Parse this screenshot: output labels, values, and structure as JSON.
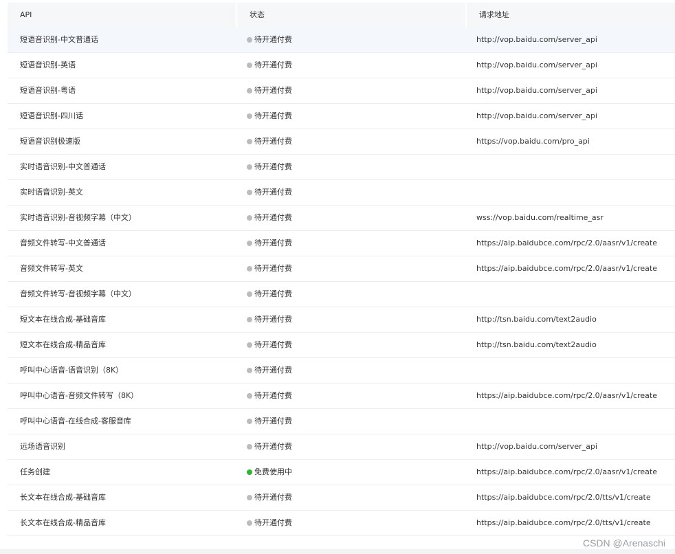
{
  "table": {
    "headers": {
      "api": "API",
      "status": "状态",
      "url": "请求地址"
    },
    "status_colors": {
      "pending": "#b9bcc1",
      "active": "#32b332"
    },
    "rows": [
      {
        "api": "短语音识别-中文普通话",
        "status": "待开通付费",
        "state": "pending",
        "url": "http://vop.baidu.com/server_api"
      },
      {
        "api": "短语音识别-英语",
        "status": "待开通付费",
        "state": "pending",
        "url": "http://vop.baidu.com/server_api"
      },
      {
        "api": "短语音识别-粤语",
        "status": "待开通付费",
        "state": "pending",
        "url": "http://vop.baidu.com/server_api"
      },
      {
        "api": "短语音识别-四川话",
        "status": "待开通付费",
        "state": "pending",
        "url": "http://vop.baidu.com/server_api"
      },
      {
        "api": "短语音识别极速版",
        "status": "待开通付费",
        "state": "pending",
        "url": "https://vop.baidu.com/pro_api"
      },
      {
        "api": "实时语音识别-中文普通话",
        "status": "待开通付费",
        "state": "pending",
        "url": ""
      },
      {
        "api": "实时语音识别-英文",
        "status": "待开通付费",
        "state": "pending",
        "url": ""
      },
      {
        "api": "实时语音识别-音视频字幕（中文）",
        "status": "待开通付费",
        "state": "pending",
        "url": "wss://vop.baidu.com/realtime_asr"
      },
      {
        "api": "音频文件转写-中文普通话",
        "status": "待开通付费",
        "state": "pending",
        "url": "https://aip.baidubce.com/rpc/2.0/aasr/v1/create"
      },
      {
        "api": "音频文件转写-英文",
        "status": "待开通付费",
        "state": "pending",
        "url": "https://aip.baidubce.com/rpc/2.0/aasr/v1/create"
      },
      {
        "api": "音频文件转写-音视频字幕（中文）",
        "status": "待开通付费",
        "state": "pending",
        "url": ""
      },
      {
        "api": "短文本在线合成-基础音库",
        "status": "待开通付费",
        "state": "pending",
        "url": "http://tsn.baidu.com/text2audio"
      },
      {
        "api": "短文本在线合成-精品音库",
        "status": "待开通付费",
        "state": "pending",
        "url": "http://tsn.baidu.com/text2audio"
      },
      {
        "api": "呼叫中心语音-语音识别（8K）",
        "status": "待开通付费",
        "state": "pending",
        "url": ""
      },
      {
        "api": "呼叫中心语音-音频文件转写（8K）",
        "status": "待开通付费",
        "state": "pending",
        "url": "https://aip.baidubce.com/rpc/2.0/aasr/v1/create"
      },
      {
        "api": "呼叫中心语音-在线合成-客服音库",
        "status": "待开通付费",
        "state": "pending",
        "url": ""
      },
      {
        "api": "远场语音识别",
        "status": "待开通付费",
        "state": "pending",
        "url": "http://vop.baidu.com/server_api"
      },
      {
        "api": "任务创建",
        "status": "免费使用中",
        "state": "active",
        "url": "https://aip.baidubce.com/rpc/2.0/aasr/v1/create"
      },
      {
        "api": "长文本在线合成-基础音库",
        "status": "待开通付费",
        "state": "pending",
        "url": "https://aip.baidubce.com/rpc/2.0/tts/v1/create"
      },
      {
        "api": "长文本在线合成-精品音库",
        "status": "待开通付费",
        "state": "pending",
        "url": "https://aip.baidubce.com/rpc/2.0/tts/v1/create"
      }
    ]
  },
  "watermark": "CSDN @Arenaschi"
}
